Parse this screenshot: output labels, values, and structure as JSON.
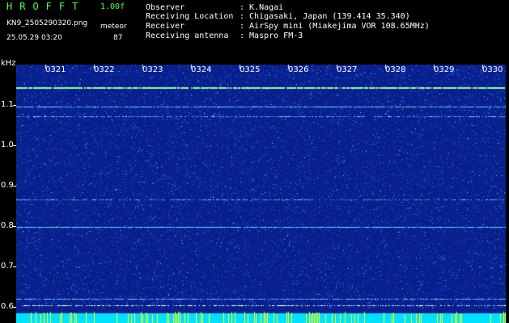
{
  "header": {
    "app_title": "HROFFT",
    "version": "1.00f",
    "filename": "KN9_2505290320.png",
    "datetime": "25.05.29 03:20",
    "meteor_label": "meteor",
    "meteor_count": "87"
  },
  "info": {
    "observer_label": "Observer",
    "observer_value": ": K.Nagai",
    "location_label": "Receiving Location",
    "location_value": ": Chigasaki, Japan (139.414 35.340)",
    "receiver_label": "Receiver",
    "receiver_value": ": AirSpy mini (Miakejima VOR 108.65MHz)",
    "antenna_label": "Receiving antenna",
    "antenna_value": ": Maspro FM-3"
  },
  "spectrogram": {
    "unit": "kHz",
    "y_ticks": [
      "1.1",
      "1.0",
      "0.9",
      "0.8",
      "0.7",
      "0.6"
    ],
    "time_ticks": [
      "0321",
      "0322",
      "0323",
      "0324",
      "0325",
      "0326",
      "0327",
      "0328",
      "0329",
      "0330"
    ],
    "colors": {
      "background": "#08208c",
      "noise_low": "#1a3cd0",
      "noise_high": "#5fd8ff",
      "signal": "#9cff8c",
      "bottom_band": "#00e0ff",
      "bottom_spike": "#ffff00"
    }
  }
}
